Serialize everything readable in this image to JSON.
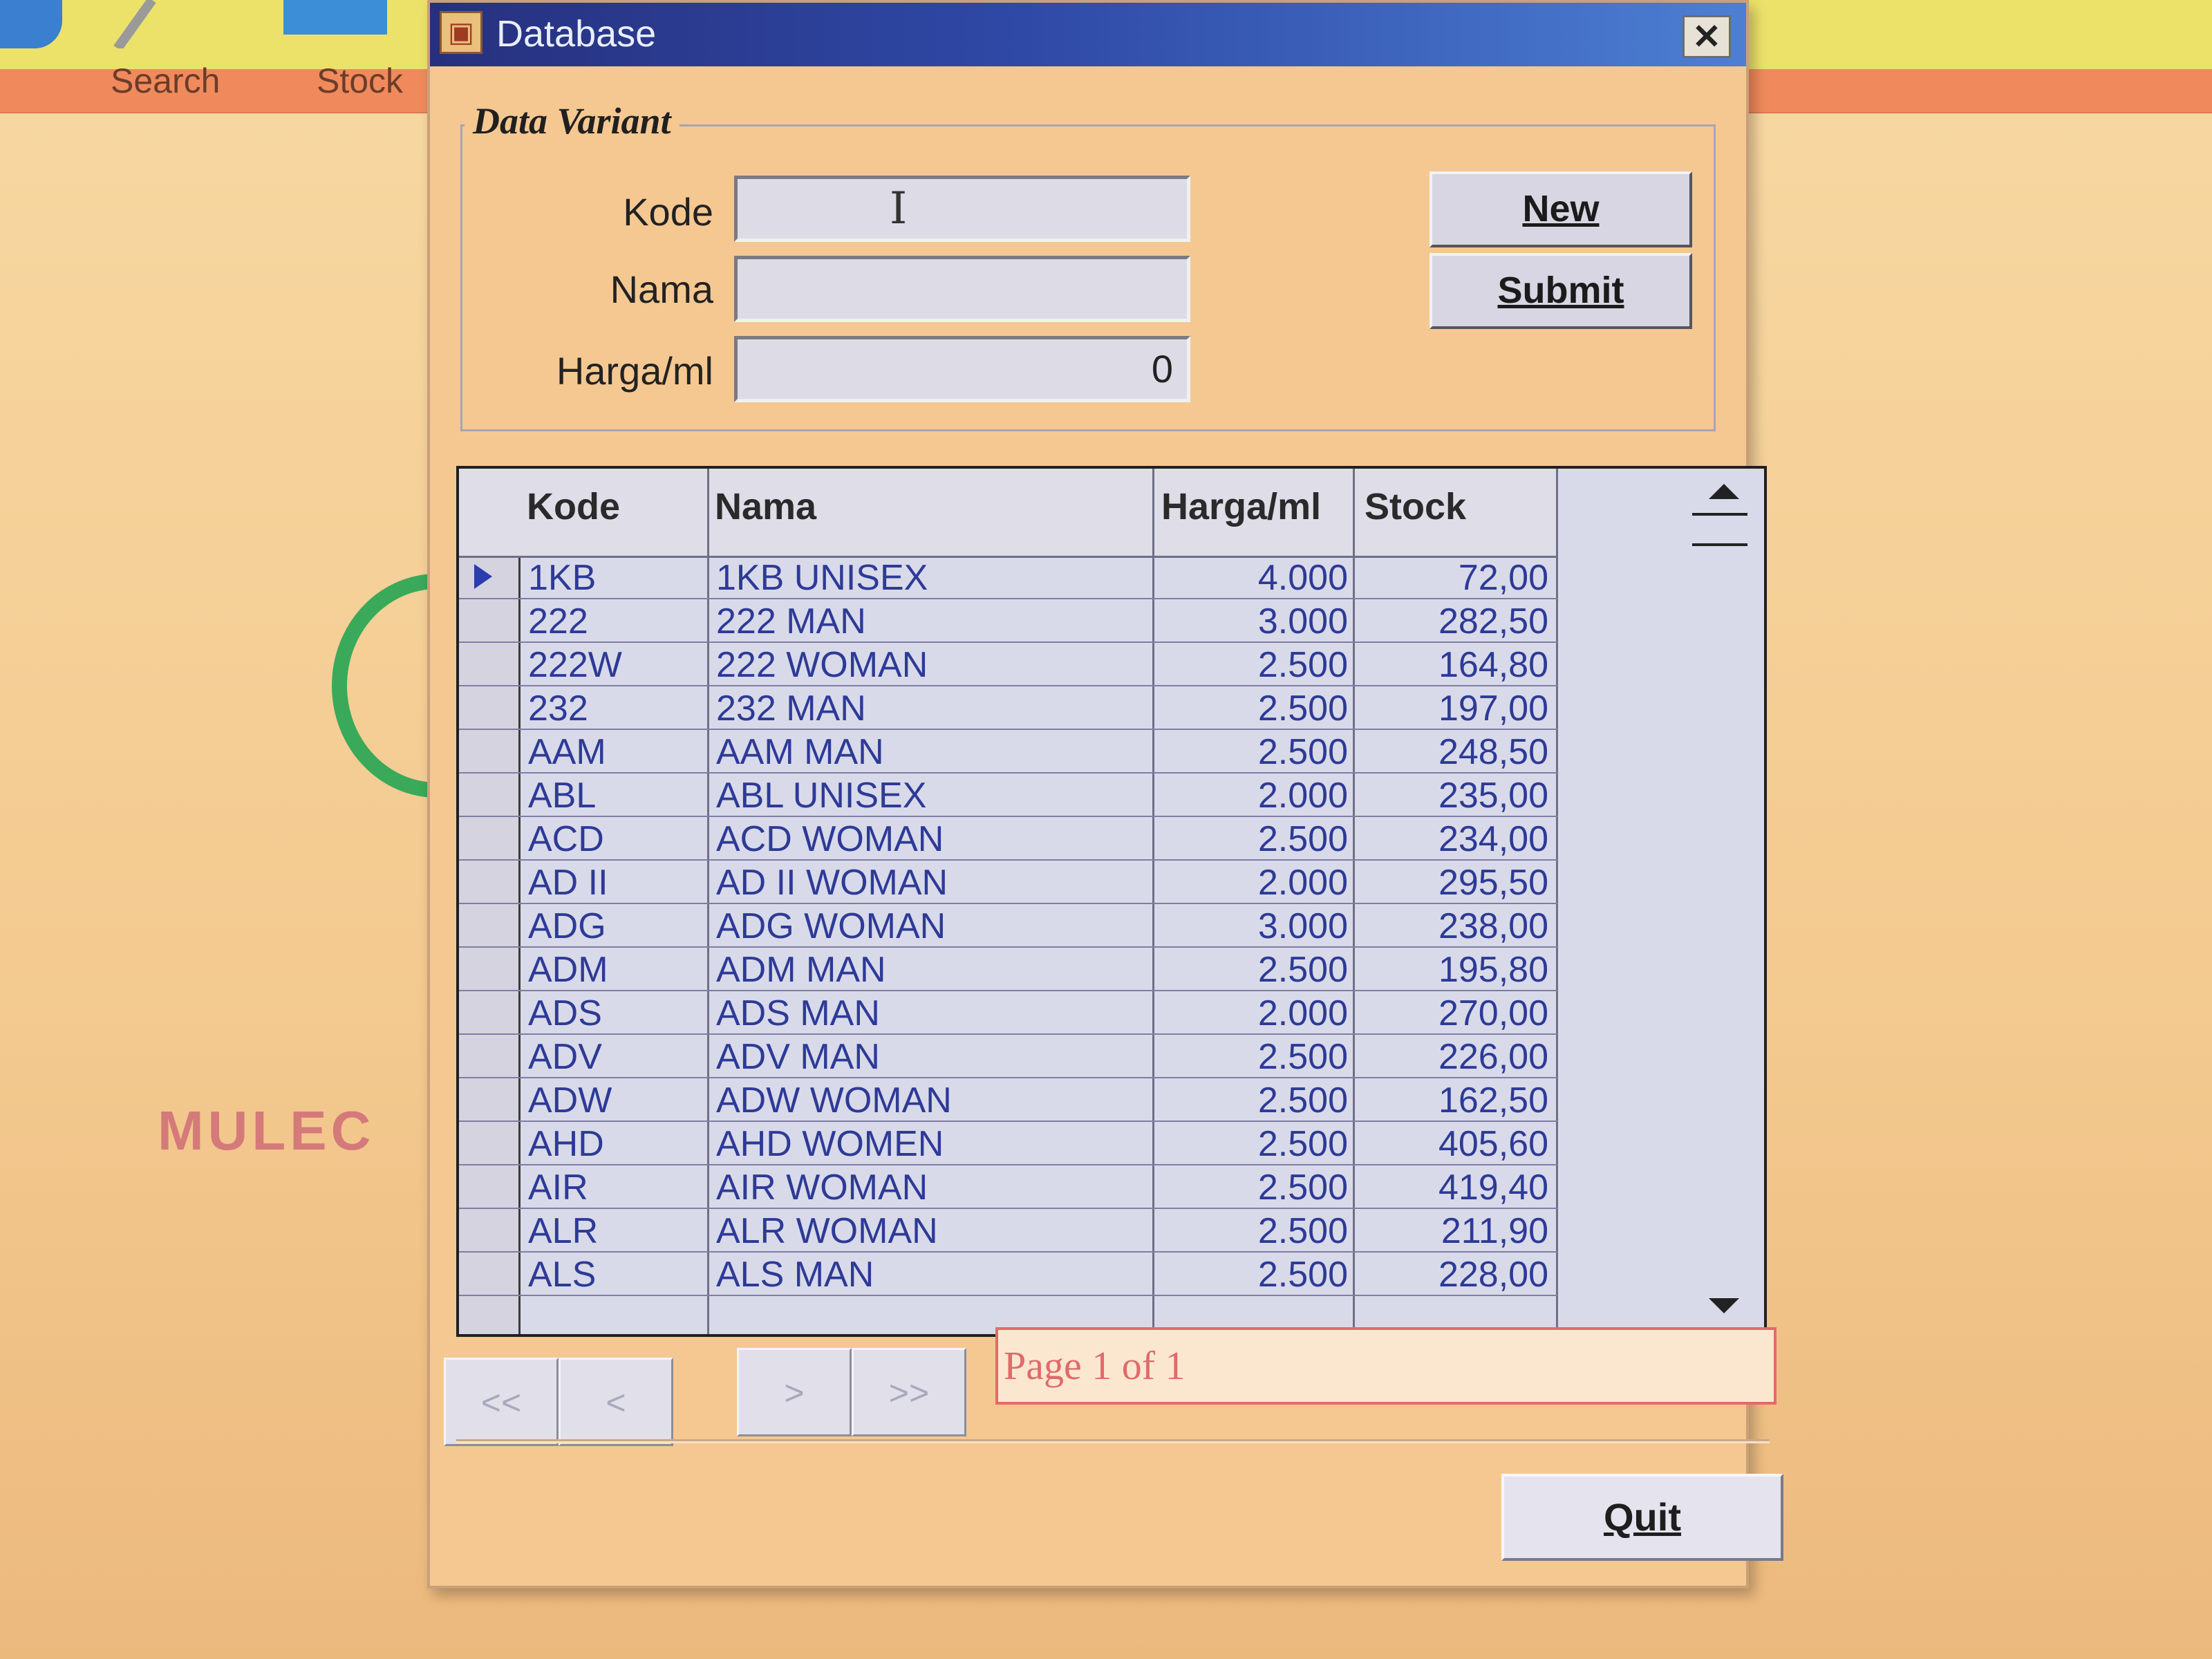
{
  "background": {
    "toolbar_items": [
      "Search",
      "Stock"
    ],
    "partial_text": "MULEC"
  },
  "window": {
    "title": "Database",
    "close_symbol": "✕"
  },
  "form": {
    "group_title": "Data Variant",
    "kode_label": "Kode",
    "kode_value": "",
    "nama_label": "Nama",
    "nama_value": "",
    "harga_label": "Harga/ml",
    "harga_value": "0",
    "new_button": "New",
    "submit_button": "Submit"
  },
  "grid": {
    "headers": [
      "Kode",
      "Nama",
      "Harga/ml",
      "Stock"
    ],
    "rows": [
      [
        "1KB",
        "1KB UNISEX",
        "4.000",
        "72,00"
      ],
      [
        "222",
        "222 MAN",
        "3.000",
        "282,50"
      ],
      [
        "222W",
        "222 WOMAN",
        "2.500",
        "164,80"
      ],
      [
        "232",
        "232 MAN",
        "2.500",
        "197,00"
      ],
      [
        "AAM",
        "AAM MAN",
        "2.500",
        "248,50"
      ],
      [
        "ABL",
        "ABL UNISEX",
        "2.000",
        "235,00"
      ],
      [
        "ACD",
        "ACD WOMAN",
        "2.500",
        "234,00"
      ],
      [
        "AD II",
        "AD II WOMAN",
        "2.000",
        "295,50"
      ],
      [
        "ADG",
        "ADG WOMAN",
        "3.000",
        "238,00"
      ],
      [
        "ADM",
        "ADM MAN",
        "2.500",
        "195,80"
      ],
      [
        "ADS",
        "ADS MAN",
        "2.000",
        "270,00"
      ],
      [
        "ADV",
        "ADV MAN",
        "2.500",
        "226,00"
      ],
      [
        "ADW",
        "ADW WOMAN",
        "2.500",
        "162,50"
      ],
      [
        "AHD",
        "AHD WOMEN",
        "2.500",
        "405,60"
      ],
      [
        "AIR",
        "AIR WOMAN",
        "2.500",
        "419,40"
      ],
      [
        "ALR",
        "ALR WOMAN",
        "2.500",
        "211,90"
      ],
      [
        "ALS",
        "ALS MAN",
        "2.500",
        "228,00"
      ]
    ]
  },
  "navigation": {
    "first": "<<",
    "prev": "<",
    "next": ">",
    "last": ">>",
    "page_status": "Page 1 of 1"
  },
  "quit_button": "Quit"
}
